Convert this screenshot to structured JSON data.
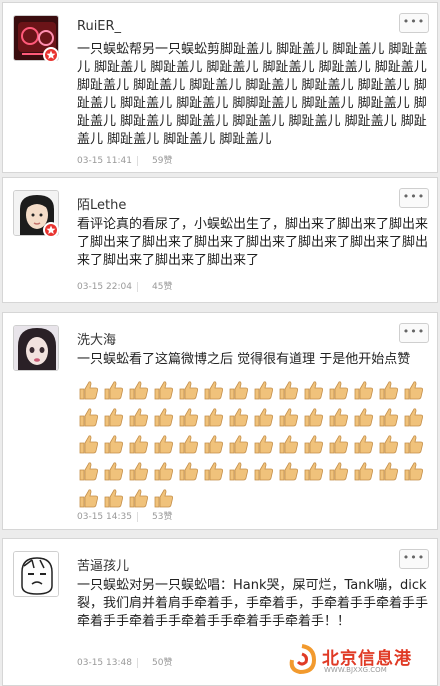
{
  "comments": [
    {
      "user": "RuiER_",
      "text": "一只蜈蚣帮另一只蜈蚣剪脚趾盖儿 脚趾盖儿 脚趾盖儿 脚趾盖儿 脚趾盖儿 脚趾盖儿 脚趾盖儿 脚趾盖儿 脚趾盖儿 脚趾盖儿 脚趾盖儿 脚趾盖儿 脚趾盖儿 脚趾盖儿 脚趾盖儿 脚趾盖儿 脚趾盖儿 脚趾盖儿 脚趾盖儿 脚脚趾盖儿 脚趾盖儿 脚趾盖儿 脚趾盖儿 脚趾盖儿 脚趾盖儿 脚趾盖儿 脚趾盖儿 脚趾盖儿 脚趾盖儿 脚趾盖儿 脚趾盖儿 脚趾盖儿",
      "time": "03-15 11:41",
      "likes": "59赞"
    },
    {
      "user": "陌Lethe",
      "text": "看评论真的看尿了，小蜈蚣出生了，脚出来了脚出来了脚出来了脚出来了脚出来了脚出来了脚出来了脚出来了脚出来了脚出来了脚出来了脚出来了脚出来了",
      "time": "03-15 22:04",
      "likes": "45赞"
    },
    {
      "user": "洗大海",
      "text": "一只蜈蚣看了这篇微博之后 觉得很有道理 于是他开始点赞",
      "thumb_count": 60,
      "time": "03-15 14:35",
      "likes": "53赞"
    },
    {
      "user": "苦逼孩儿",
      "text": "一只蜈蚣对另一只蜈蚣唱：Hank哭，屎可烂，Tank嘣，dick裂，我们肩并着肩手牵着手，手牵着手，手牵着手手牵着手手牵着手手牵着手手牵着手手牵着手手牵着手！！",
      "time": "03-15 13:48",
      "likes": "50赞"
    }
  ],
  "more_label": "•••",
  "watermark": {
    "text": "北京信息港",
    "sub": "WWW.BJXXG.COM"
  },
  "colors": {
    "badge": "#e8332f",
    "watermark": "#e03a25",
    "thumb": "#f0c27b"
  }
}
